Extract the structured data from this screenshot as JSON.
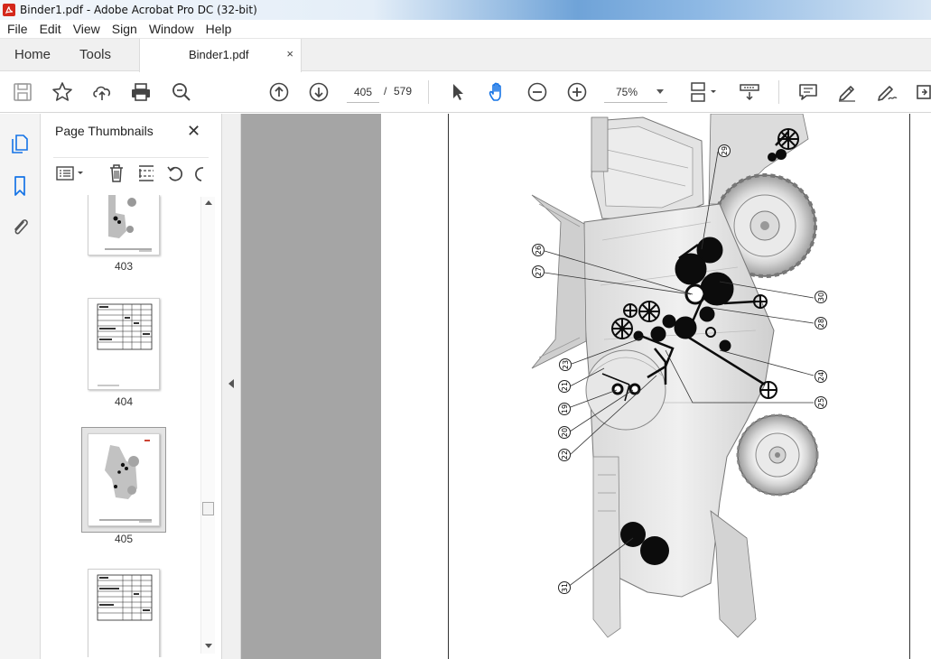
{
  "window": {
    "title": "Binder1.pdf - Adobe Acrobat Pro DC (32-bit)"
  },
  "menu": {
    "items": [
      "File",
      "Edit",
      "View",
      "Sign",
      "Window",
      "Help"
    ]
  },
  "tabs": {
    "home": "Home",
    "tools": "Tools",
    "document": "Binder1.pdf",
    "close": "×"
  },
  "toolbar": {
    "icons": [
      "save-icon",
      "bookmark-star-icon",
      "share-icon",
      "print-icon",
      "zoom-search-icon",
      "prev-page-icon",
      "next-page-icon",
      "select-cursor-icon",
      "hand-tool-icon",
      "zoom-out-icon",
      "zoom-in-icon",
      "page-display-icon",
      "scroll-mode-icon",
      "comment-icon",
      "highlight-icon",
      "sign-icon",
      "tools-icon"
    ],
    "current_page": "405",
    "page_separator": "/",
    "total_pages": "579",
    "zoom": "75%"
  },
  "thumbnails": {
    "title": "Page Thumbnails",
    "close": "✕",
    "pages": [
      {
        "label": "403"
      },
      {
        "label": "404"
      },
      {
        "label": "405",
        "selected": true
      },
      {
        "label": ""
      }
    ]
  },
  "callouts": [
    "29",
    "26",
    "27",
    "30",
    "28",
    "23",
    "21",
    "19",
    "20",
    "22",
    "24",
    "25",
    "31"
  ],
  "colors": {
    "title_gradient": "#6fa3d8",
    "accent_hand": "#1473e6",
    "pdf_red": "#d4281c",
    "gray_page": "#a5a5a5"
  }
}
